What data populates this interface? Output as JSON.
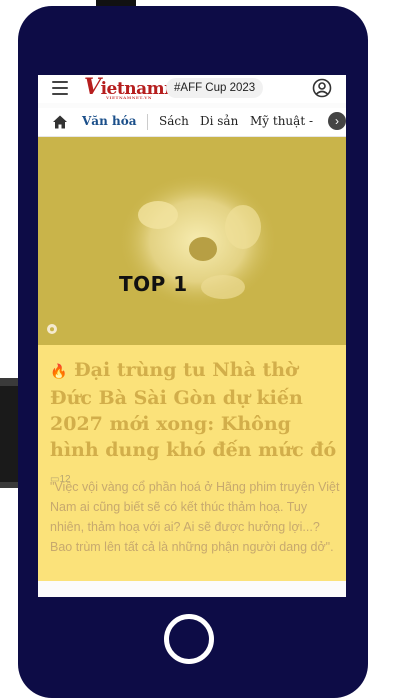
{
  "header": {
    "logo_text": "ietnamnet",
    "logo_initial": "V",
    "logo_tagline": "VIETNAMNET.VN",
    "hashtag": "#AFF Cup 2023"
  },
  "categories": {
    "active": "Văn hóa",
    "items": [
      "Sách",
      "Di sản",
      "Mỹ thuật -"
    ]
  },
  "article": {
    "overlay_label": "TOP 1",
    "title": "Đại trùng tu Nhà thờ Đức Bà Sài Gòn dự kiến 2027 mới xong: Không hình dung khó đến mức đó",
    "comment_count": "12",
    "description": "\"Việc vội vàng cổ phần hoá ở Hãng phim truyện Việt Nam ai cũng biết sẽ có kết thúc thảm hoạ. Tuy nhiên, thảm hoạ với ai? Ai sẽ được hưởng lợi...? Bao trùm lên tất cả là những phận người dang dở\"."
  },
  "icons": {
    "menu": "hamburger-icon",
    "user": "user-circle-icon",
    "home": "home-icon",
    "next": "chevron-right-icon",
    "camera": "camera-icon",
    "fire": "fire-icon",
    "comment": "comment-icon"
  },
  "colors": {
    "phone_frame": "#0d0c46",
    "category_active": "#1b4f8a",
    "card_background": "#fbe27a",
    "hero_tint": "#c9b44a"
  }
}
